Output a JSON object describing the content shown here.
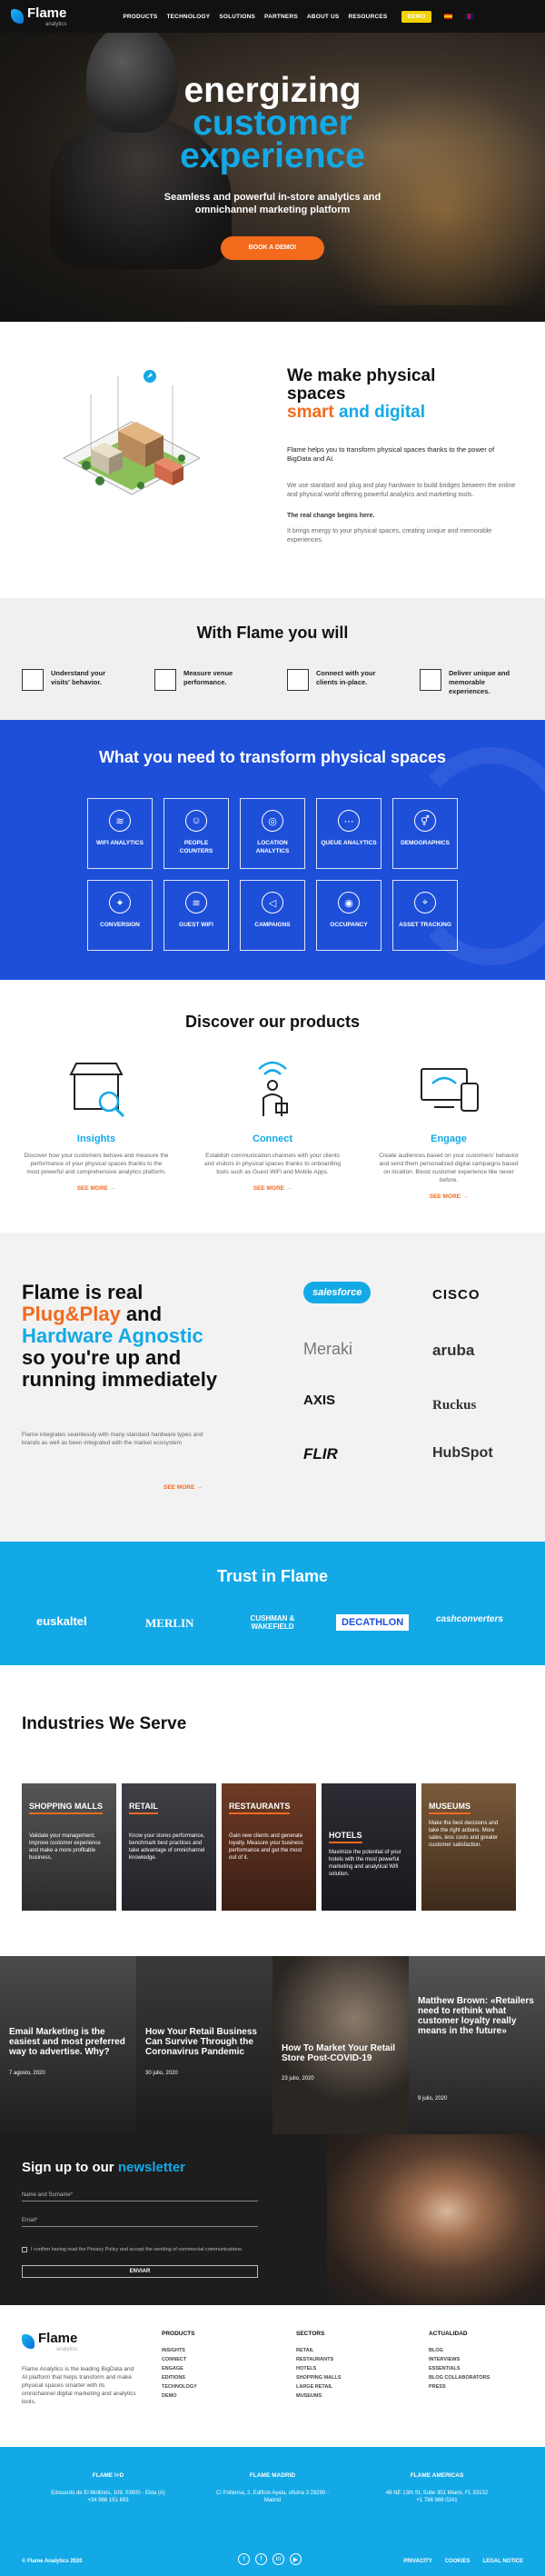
{
  "header": {
    "logo": "Flame",
    "logo_sub": "analytics",
    "nav": [
      "PRODUCTS",
      "TECHNOLOGY",
      "SOLUTIONS",
      "PARTNERS",
      "ABOUT US",
      "RESOURCES"
    ],
    "demo": "DEMO"
  },
  "hero": {
    "line1": "energizing",
    "line2": "customer",
    "line3": "experience",
    "subtitle": "Seamless and powerful in-store analytics and omnichannel marketing platform",
    "button": "BOOK A DEMO!"
  },
  "physical": {
    "title1": "We make physical",
    "title2": "spaces",
    "title3a": "smart",
    "title3b": "and digital",
    "p1": "Flame helps you to transform physical spaces thanks to the power of BigData and AI.",
    "p2": "We use standard and plug and play hardware to build bridges between the online and physical world offering powerful analytics and marketing tools.",
    "p3": "The real change begins here.",
    "p4": "It brings energy to your physical spaces, creating unique and memorable experiences."
  },
  "with_flame": {
    "title": "With Flame you will",
    "items": [
      "Understand your visits' behavior.",
      "Measure venue performance.",
      "Connect with your clients in-place.",
      "Deliver unique and memorable experiences."
    ]
  },
  "transform": {
    "title": "What you need to transform physical spaces",
    "items": [
      {
        "label": "WIFI ANALYTICS",
        "icon": "wifi-icon"
      },
      {
        "label": "PEOPLE COUNTERS",
        "icon": "people-icon"
      },
      {
        "label": "LOCATION ANALYTICS",
        "icon": "location-icon"
      },
      {
        "label": "QUEUE ANALYTICS",
        "icon": "queue-icon"
      },
      {
        "label": "DEMOGRAPHICS",
        "icon": "demographics-icon"
      },
      {
        "label": "CONVERSION",
        "icon": "conversion-icon"
      },
      {
        "label": "GUEST WIFI",
        "icon": "guest-wifi-icon"
      },
      {
        "label": "CAMPAIGNS",
        "icon": "megaphone-icon"
      },
      {
        "label": "OCCUPANCY",
        "icon": "occupancy-icon"
      },
      {
        "label": "ASSET TRACKING",
        "icon": "asset-icon"
      }
    ]
  },
  "products": {
    "title": "Discover our products",
    "items": [
      {
        "name": "Insights",
        "desc": "Discover how your customers behave and measure the performance of your physical spaces thanks to the most powerful and comprehensive analytics platform.",
        "more": "SEE MORE"
      },
      {
        "name": "Connect",
        "desc": "Establish communication channels with your clients and visitors in physical spaces thanks to onboarding tools such as Guest WiFi and Mobile Apps.",
        "more": "SEE MORE"
      },
      {
        "name": "Engage",
        "desc": "Create audiences based on your customers' behavior and send them personalized digital campaigns based on location. Boost customer experience like never before.",
        "more": "SEE MORE"
      }
    ]
  },
  "plug": {
    "t1": "Flame is real",
    "t2": "Plug&Play",
    "t2b": " and",
    "t3": "Hardware Agnostic",
    "t4": "so you're up and running immediately",
    "desc": "Flame integrates seamlessly with many standard hardware types and brands as well as been integrated with the market ecosystem",
    "more": "SEE MORE",
    "brands": [
      "salesforce",
      "CISCO",
      "Meraki",
      "aruba",
      "AXIS",
      "Ruckus",
      "FLIR",
      "HubSpot"
    ]
  },
  "trust": {
    "title": "Trust in Flame",
    "logos": [
      "euskaltel",
      "MERLIN",
      "CUSHMAN & WAKEFIELD",
      "DECATHLON",
      "cashconverters"
    ]
  },
  "industries": {
    "title": "Industries We Serve",
    "items": [
      {
        "name": "SHOPPING MALLS",
        "desc": "Validate your management, improve customer experience and make a more profitable business."
      },
      {
        "name": "RETAIL",
        "desc": "Know your stores performance, benchmark best practices and take advantage of omnichannel knowledge."
      },
      {
        "name": "RESTAURANTS",
        "desc": "Gain new clients and generate loyalty. Measure your business performance and get the most out of it."
      },
      {
        "name": "HOTELS",
        "desc": "Maximize the potential of your hotels with the most powerful marketing and analytical Wifi solution."
      },
      {
        "name": "MUSEUMS",
        "desc": "Make the best decisions and take the right actions. More sales, less costs and greater customer satisfaction."
      }
    ]
  },
  "blog": {
    "items": [
      {
        "title": "Email Marketing is the easiest and most preferred way to advertise. Why?",
        "date": "7 agosto, 2020"
      },
      {
        "title": "How Your Retail Business Can Survive Through the Coronavirus Pandemic",
        "date": "30 julio, 2020"
      },
      {
        "title": "How To Market Your Retail Store Post-COVID-19",
        "date": "23 julio, 2020"
      },
      {
        "title": "Matthew Brown: «Retailers need to rethink what customer loyalty really means in the future»",
        "date": "9 julio, 2020"
      }
    ]
  },
  "newsletter": {
    "title_a": "Sign up to our",
    "title_b": "newsletter",
    "name_placeholder": "Name and Surname*",
    "email_placeholder": "Email*",
    "consent": "I confirm having read the Privacy Policy and accept the sending of commercial communications.",
    "send": "ENVIAR"
  },
  "footer": {
    "desc": "Flame Analytics is the leading BigData and AI platform that helps transform and make physical spaces smarter with its omnichannel digital marketing and analytics tools.",
    "cols": [
      {
        "title": "PRODUCTS",
        "links": [
          "INSIGHTS",
          "CONNECT",
          "ENGAGE",
          "EDITIONS",
          "TECHNOLOGY",
          "DEMO"
        ]
      },
      {
        "title": "SECTORS",
        "links": [
          "RETAIL",
          "RESTAURANTS",
          "HOTELS",
          "SHOPPING MALLS",
          "LARGE RETAIL",
          "MUSEUMS"
        ]
      },
      {
        "title": "ACTUALIDAD",
        "links": [
          "BLOG",
          "INTERVIEWS",
          "ESSENTIALS",
          "BLOG COLLABORATORS",
          "PRESS"
        ]
      }
    ]
  },
  "offices": {
    "items": [
      {
        "name": "FLAME I+D",
        "addr": "Edouardo de El Mollinós, 109, 03600 - Elda (A)",
        "tel": "+34 966 151 693"
      },
      {
        "name": "FLAME MADRID",
        "addr": "C/ Pollensa, 2, Edificio Ayala, oficina 3 28290 - Madrid",
        "tel": ""
      },
      {
        "name": "FLAME AMERICAS",
        "addr": "48 NE 13th St, Suite 301 Miami, FL 33132",
        "tel": "+1 786 988 0241"
      }
    ],
    "copyright": "© Flame Analytics 2020",
    "legal": [
      "PRIVACITY",
      "COOKIES",
      "LEGAL NOTICE"
    ],
    "social": [
      "twitter-icon",
      "facebook-icon",
      "linkedin-icon",
      "youtube-icon"
    ]
  },
  "colors": {
    "orange": "#f36a1d",
    "blue": "#13a9e6",
    "royal": "#1e4fd9"
  }
}
